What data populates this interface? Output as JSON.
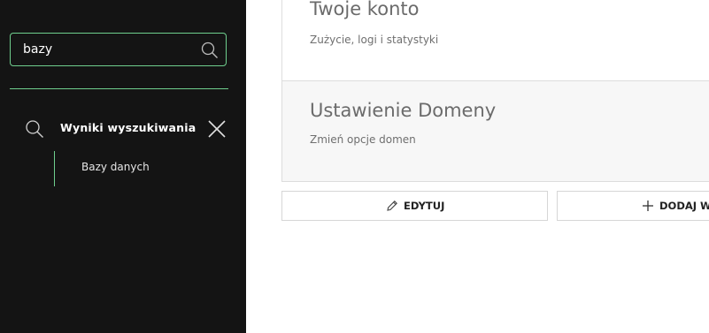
{
  "sidebar": {
    "search": {
      "value": "bazy",
      "icon": "search-icon"
    },
    "results": {
      "title": "Wyniki wyszukiwania",
      "items": [
        {
          "label": "Bazy danych"
        }
      ]
    }
  },
  "main": {
    "cards": [
      {
        "title": "Twoje konto",
        "subtitle": "Zużycie, logi i statystyki"
      },
      {
        "title": "Ustawienie Domeny",
        "subtitle": "Zmień opcje domen"
      }
    ],
    "buttons": {
      "edit_label": "EDYTUJ",
      "add_label": "DODAJ W"
    }
  },
  "colors": {
    "sidebar_bg": "#141414",
    "accent": "#6fcf8e",
    "card_alt_bg": "#f7f7f7"
  }
}
